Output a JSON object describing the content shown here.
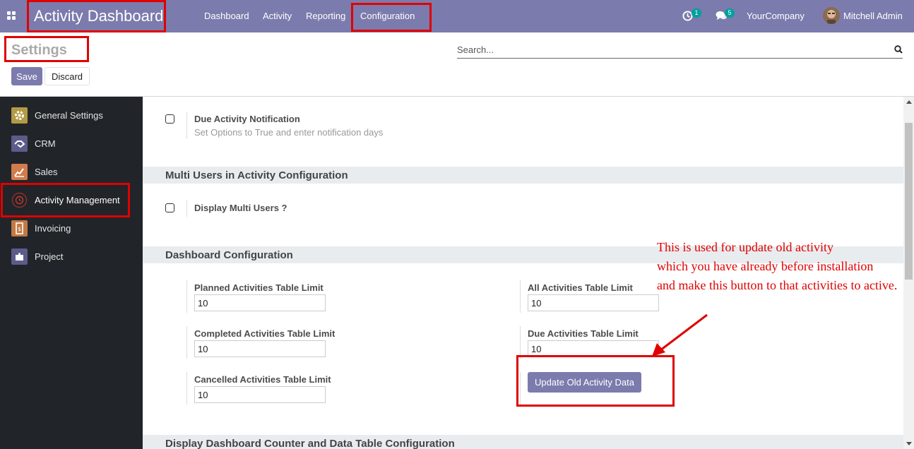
{
  "navbar": {
    "brand": "Activity Dashboard",
    "menu": [
      "Dashboard",
      "Activity",
      "Reporting",
      "Configuration"
    ],
    "activity_badge": "1",
    "message_badge": "5",
    "company": "YourCompany",
    "user": "Mitchell Admin",
    "bg_color": "#7c7bad"
  },
  "control_panel": {
    "title": "Settings",
    "search_placeholder": "Search...",
    "save_label": "Save",
    "discard_label": "Discard"
  },
  "sidebar": {
    "items": [
      {
        "label": "General Settings",
        "icon": "gear-icon",
        "color": "#b39a45"
      },
      {
        "label": "CRM",
        "icon": "handshake-icon",
        "color": "#5b5c8a"
      },
      {
        "label": "Sales",
        "icon": "chart-icon",
        "color": "#d27b4c"
      },
      {
        "label": "Activity Management",
        "icon": "clock-history-icon",
        "color": "#3a3a3a"
      },
      {
        "label": "Invoicing",
        "icon": "invoice-icon",
        "color": "#c27a44"
      },
      {
        "label": "Project",
        "icon": "puzzle-icon",
        "color": "#5b5c8a"
      }
    ]
  },
  "settings": {
    "due_notification": {
      "title": "Due Activity Notification",
      "description": "Set Options to True and enter notification days"
    },
    "multi_users_section": "Multi Users in Activity Configuration",
    "multi_users": {
      "title": "Display Multi Users ?"
    },
    "dashboard_section": "Dashboard Configuration",
    "fields": [
      {
        "label": "Planned Activities Table Limit",
        "value": "10"
      },
      {
        "label": "All Activities Table Limit",
        "value": "10"
      },
      {
        "label": "Completed Activities Table Limit",
        "value": "10"
      },
      {
        "label": "Due Activities Table Limit",
        "value": "10"
      },
      {
        "label": "Cancelled Activities Table Limit",
        "value": "10"
      }
    ],
    "update_button": "Update Old Activity Data",
    "counter_section": "Display Dashboard Counter and Data Table Configuration"
  },
  "annotation": {
    "lines": [
      "This is used for update old activity",
      "which you have already before installation",
      "and make this button to that activities to active."
    ],
    "color": "#e00000"
  }
}
